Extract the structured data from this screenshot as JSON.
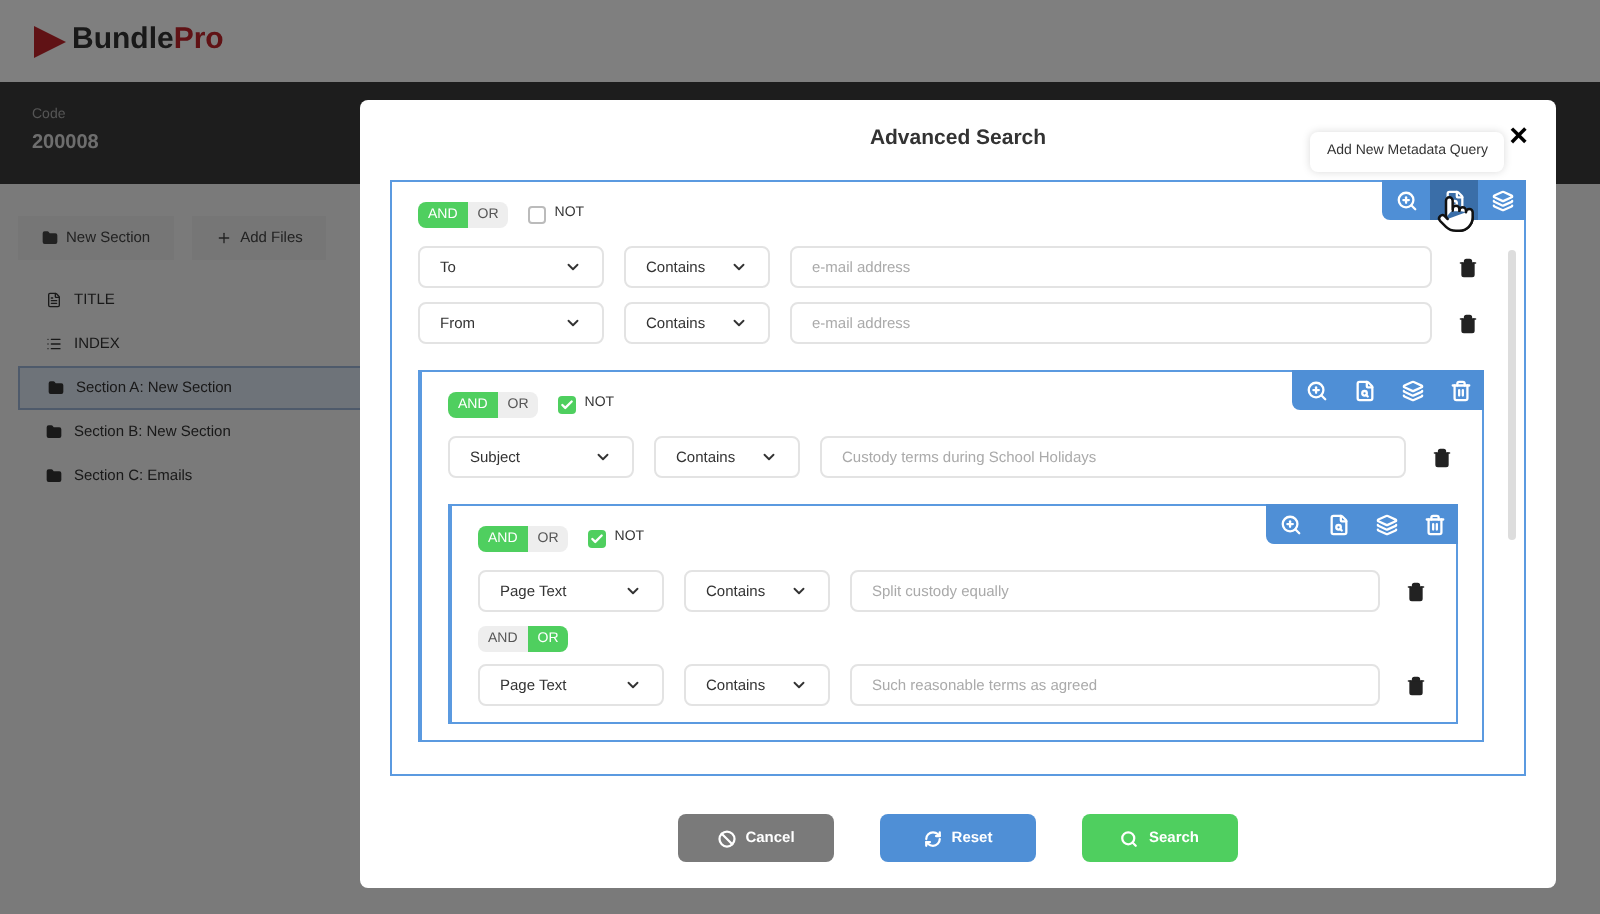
{
  "app": {
    "logo_main": "Bundle",
    "logo_accent": "Pro"
  },
  "header": {
    "code_label": "Code",
    "code": "200008"
  },
  "toolbar": [
    {
      "kind": "folder",
      "label": "New Section"
    },
    {
      "kind": "plus",
      "label": "Add Files"
    }
  ],
  "sidebar": {
    "items": [
      {
        "kind": "document",
        "label": "TITLE",
        "selected": false
      },
      {
        "kind": "list",
        "label": "INDEX",
        "selected": false
      },
      {
        "kind": "folder",
        "label": "Section A: New Section",
        "selected": true
      },
      {
        "kind": "folder",
        "label": "Section B: New Section",
        "selected": false
      },
      {
        "kind": "folder",
        "label": "Section C: Emails",
        "selected": false
      }
    ]
  },
  "modal": {
    "title": "Advanced Search",
    "close": "×",
    "query": {
      "operators": [
        {
          "label": "AND",
          "selected": true
        },
        {
          "label": "OR",
          "selected": false
        }
      ],
      "not": {
        "label": "NOT",
        "checked": false
      },
      "actions": [
        {
          "kind": "zoom",
          "hovered": false
        },
        {
          "kind": "file-search",
          "hovered": true,
          "tooltip": "Add New Metadata Query"
        },
        {
          "kind": "layers-add",
          "hovered": false
        }
      ],
      "items": [
        {
          "kind": "condition",
          "field": "To",
          "operator": "Contains",
          "placeholder": "e-mail address"
        },
        {
          "kind": "condition",
          "field": "From",
          "operator": "Contains",
          "placeholder": "e-mail address"
        },
        {
          "kind": "group",
          "operators": [
            {
              "label": "AND",
              "selected": true
            },
            {
              "label": "OR",
              "selected": false
            }
          ],
          "not": {
            "label": "NOT",
            "checked": true
          },
          "actions": [
            {
              "kind": "zoom",
              "hovered": false
            },
            {
              "kind": "file-search",
              "hovered": false
            },
            {
              "kind": "layers-add",
              "hovered": false
            },
            {
              "kind": "trash",
              "hovered": false
            }
          ],
          "items": [
            {
              "kind": "condition",
              "field": "Subject",
              "operator": "Contains",
              "placeholder": "Custody terms during School Holidays"
            },
            {
              "kind": "group",
              "operators": [
                {
                  "label": "AND",
                  "selected": true
                },
                {
                  "label": "OR",
                  "selected": false
                }
              ],
              "not": {
                "label": "NOT",
                "checked": true
              },
              "actions": [
                {
                  "kind": "zoom",
                  "hovered": false
                },
                {
                  "kind": "file-search",
                  "hovered": false
                },
                {
                  "kind": "layers-add",
                  "hovered": false
                },
                {
                  "kind": "trash",
                  "hovered": false
                }
              ],
              "items": [
                {
                  "kind": "condition",
                  "field": "Page Text",
                  "operator": "Contains",
                  "placeholder": "Split custody equally"
                },
                {
                  "kind": "condition",
                  "join": [
                    {
                      "label": "AND",
                      "selected": false
                    },
                    {
                      "label": "OR",
                      "selected": true
                    }
                  ],
                  "field": "Page Text",
                  "operator": "Contains",
                  "placeholder": "Such reasonable terms as agreed"
                }
              ]
            }
          ]
        }
      ]
    },
    "buttons": [
      {
        "kind": "cancel",
        "label": "Cancel"
      },
      {
        "kind": "reset",
        "label": "Reset"
      },
      {
        "kind": "search",
        "label": "Search"
      }
    ]
  }
}
